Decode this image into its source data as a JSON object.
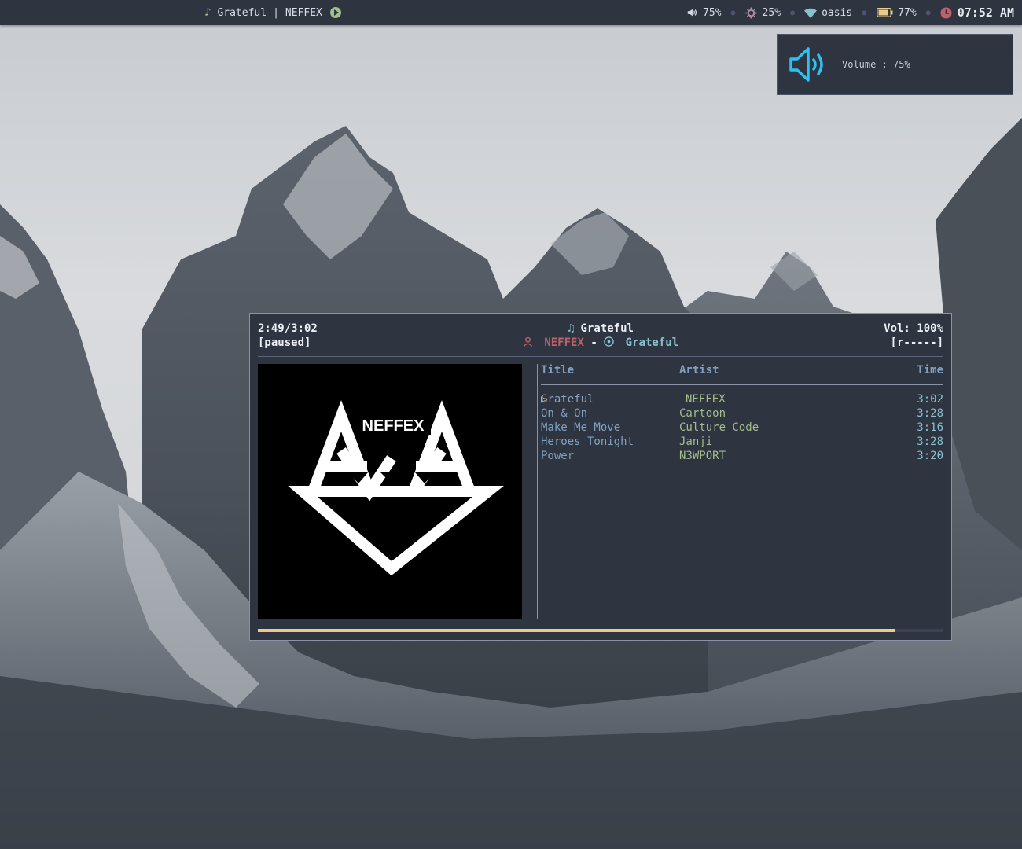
{
  "topbar": {
    "now_playing": {
      "icon": "music-note-icon",
      "title": "Grateful",
      "separator": "|",
      "artist": "NEFFEX",
      "play_icon": "play-circle-icon"
    },
    "volume": {
      "icon": "speaker-icon",
      "value": "75%"
    },
    "brightness": {
      "icon": "sun-icon",
      "value": "25%"
    },
    "wifi": {
      "icon": "wifi-icon",
      "value": "oasis"
    },
    "battery": {
      "icon": "battery-icon",
      "value": "77%"
    },
    "clock": {
      "icon": "clock-icon",
      "value": "07:52 AM"
    },
    "colors": {
      "accent_green": "#a3be8c",
      "clock_red": "#bf616a",
      "brightness_purple": "#b48ead",
      "wifi_cyan": "#88c0d0",
      "battery_yellow": "#ebcb8b"
    }
  },
  "notification": {
    "icon": "speaker-volume-icon",
    "text": "Volume : 75%",
    "icon_color": "#2ec0f0"
  },
  "player": {
    "elapsed_total": "2:49/3:02",
    "state": "[paused]",
    "title_icon": "music-notes-icon",
    "title": "Grateful",
    "artist_icon": "user-icon",
    "artist": "NEFFEX",
    "dash": "-",
    "album_icon": "disc-icon",
    "album": "Grateful",
    "volume": "Vol: 100%",
    "volume_bar": "[r-----]",
    "album_art": {
      "icon": "neffex-logo",
      "text": "NEFFEX"
    },
    "playlist": {
      "headers": {
        "title": "Title",
        "artist": "Artist",
        "time": "Time"
      },
      "rows": [
        {
          "title": "Grateful",
          "artist": "NEFFEX",
          "time": "3:02",
          "current": true
        },
        {
          "title": "On & On",
          "artist": "Cartoon",
          "time": "3:28"
        },
        {
          "title": "Make Me Move",
          "artist": "Culture Code",
          "time": "3:16"
        },
        {
          "title": "Heroes Tonight",
          "artist": "Janji",
          "time": "3:28"
        },
        {
          "title": "Power",
          "artist": "N3WPORT",
          "time": "3:20"
        }
      ]
    },
    "progress": 0.93,
    "progress_color": "#ebcb8b"
  }
}
